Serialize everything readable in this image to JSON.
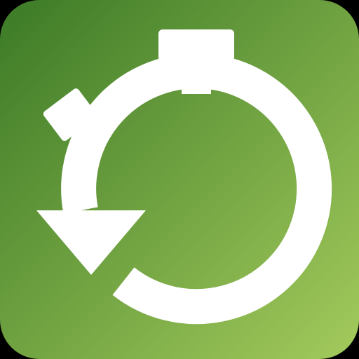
{
  "app_icon": {
    "icon": "stopwatch-restart-icon",
    "colors": {
      "gradient_start": "#3c7a26",
      "gradient_end": "#a3ca5c",
      "glyph": "#ffffff",
      "background": "#000000"
    }
  }
}
